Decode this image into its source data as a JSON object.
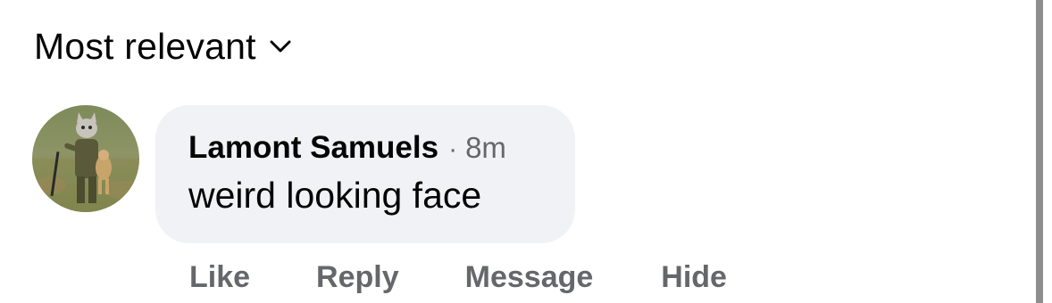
{
  "sort": {
    "label": "Most relevant",
    "icon": "chevron-down-icon"
  },
  "comment": {
    "author": "Lamont Samuels",
    "separator": "·",
    "time": "8m",
    "text": "weird looking face",
    "avatar_alt": "cat-farmer-avatar"
  },
  "actions": {
    "like": "Like",
    "reply": "Reply",
    "message": "Message",
    "hide": "Hide"
  },
  "colors": {
    "text_primary": "#050505",
    "text_secondary": "#65676b",
    "bubble_bg": "#f0f2f5",
    "scrollbar": "#8e8e8e"
  }
}
